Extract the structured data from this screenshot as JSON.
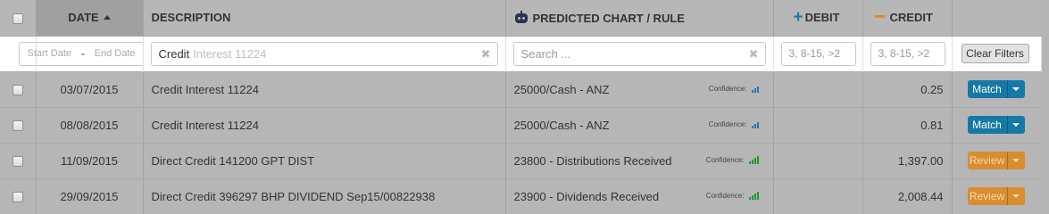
{
  "columns": {
    "date": "DATE",
    "description": "DESCRIPTION",
    "predicted": "PREDICTED CHART / RULE",
    "debit": "DEBIT",
    "credit": "CREDIT"
  },
  "icons": {
    "sort": "sort-ascending-icon",
    "predicted": "robot-icon",
    "debit": "plus-icon",
    "credit": "minus-icon"
  },
  "colors": {
    "debit_accent": "#1b79a6",
    "credit_accent": "#e08a2a",
    "match_button": "#1678a6",
    "review_button": "#d88d2f",
    "confidence_blue": "#1d7ab6",
    "confidence_green": "#1e9a2e"
  },
  "filters": {
    "start_date_placeholder": "Start Date",
    "separator": "-",
    "end_date_placeholder": "End Date",
    "description_value": "Credit",
    "description_autocomplete": "Interest 11224",
    "search_placeholder": "Search ...",
    "debit_placeholder": "3, 8-15, >2",
    "credit_placeholder": "3, 8-15, >2",
    "clear_filters": "Clear Filters"
  },
  "confidence_label": "Confidence:",
  "rows": [
    {
      "date": "03/07/2015",
      "description": "Credit Interest 11224",
      "predicted": "25000/Cash - ANZ",
      "confidence_level": 3,
      "confidence_color": "blue",
      "debit": "",
      "credit": "0.25",
      "action": "Match",
      "action_type": "match"
    },
    {
      "date": "08/08/2015",
      "description": "Credit Interest 11224",
      "predicted": "25000/Cash - ANZ",
      "confidence_level": 3,
      "confidence_color": "blue",
      "debit": "",
      "credit": "0.81",
      "action": "Match",
      "action_type": "match"
    },
    {
      "date": "11/09/2015",
      "description": "Direct Credit 141200 GPT DIST",
      "predicted": "23800 - Distributions Received",
      "confidence_level": 4,
      "confidence_color": "green",
      "debit": "",
      "credit": "1,397.00",
      "action": "Review",
      "action_type": "review"
    },
    {
      "date": "29/09/2015",
      "description": "Direct Credit 396297 BHP DIVIDEND Sep15/00822938",
      "predicted": "23900 - Dividends Received",
      "confidence_level": 4,
      "confidence_color": "green",
      "debit": "",
      "credit": "2,008.44",
      "action": "Review",
      "action_type": "review"
    }
  ]
}
